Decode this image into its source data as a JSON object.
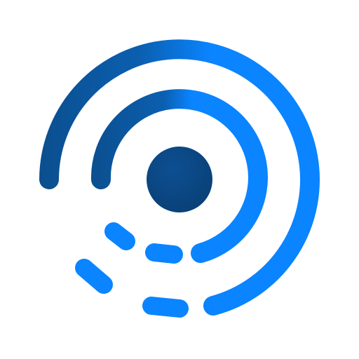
{
  "app_icon": {
    "icon": "signal-broadcast-icon",
    "colors": {
      "background": "#ffffff",
      "dark_blue": "#0b4f8f",
      "mid_blue": "#0a6fd6",
      "bright_blue": "#0a84ff"
    }
  }
}
